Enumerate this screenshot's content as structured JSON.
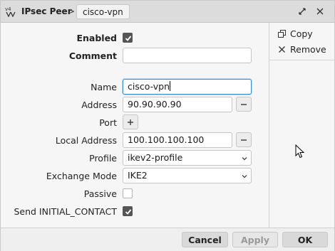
{
  "titlebar": {
    "app_icon": "ipsec-app-icon",
    "title": "IPsec Peer",
    "separator": ">",
    "current": "cisco-vpn"
  },
  "form": {
    "enabled": {
      "label": "Enabled",
      "checked": true
    },
    "comment": {
      "label": "Comment",
      "value": ""
    },
    "name": {
      "label": "Name",
      "value": "cisco-vpn"
    },
    "address": {
      "label": "Address",
      "value": "90.90.90.90"
    },
    "port": {
      "label": "Port"
    },
    "local_address": {
      "label": "Local Address",
      "value": "100.100.100.100"
    },
    "profile": {
      "label": "Profile",
      "value": "ikev2-profile"
    },
    "exchange_mode": {
      "label": "Exchange Mode",
      "value": "IKE2"
    },
    "passive": {
      "label": "Passive",
      "checked": false
    },
    "send_initial_contact": {
      "label": "Send INITIAL_CONTACT",
      "checked": true
    }
  },
  "side": {
    "copy": "Copy",
    "remove": "Remove"
  },
  "footer": {
    "cancel": "Cancel",
    "apply": "Apply",
    "ok": "OK"
  },
  "colors": {
    "focus_border": "#3b8fd9",
    "checkbox_on": "#555555",
    "disabled_text": "#9a9a9a"
  }
}
